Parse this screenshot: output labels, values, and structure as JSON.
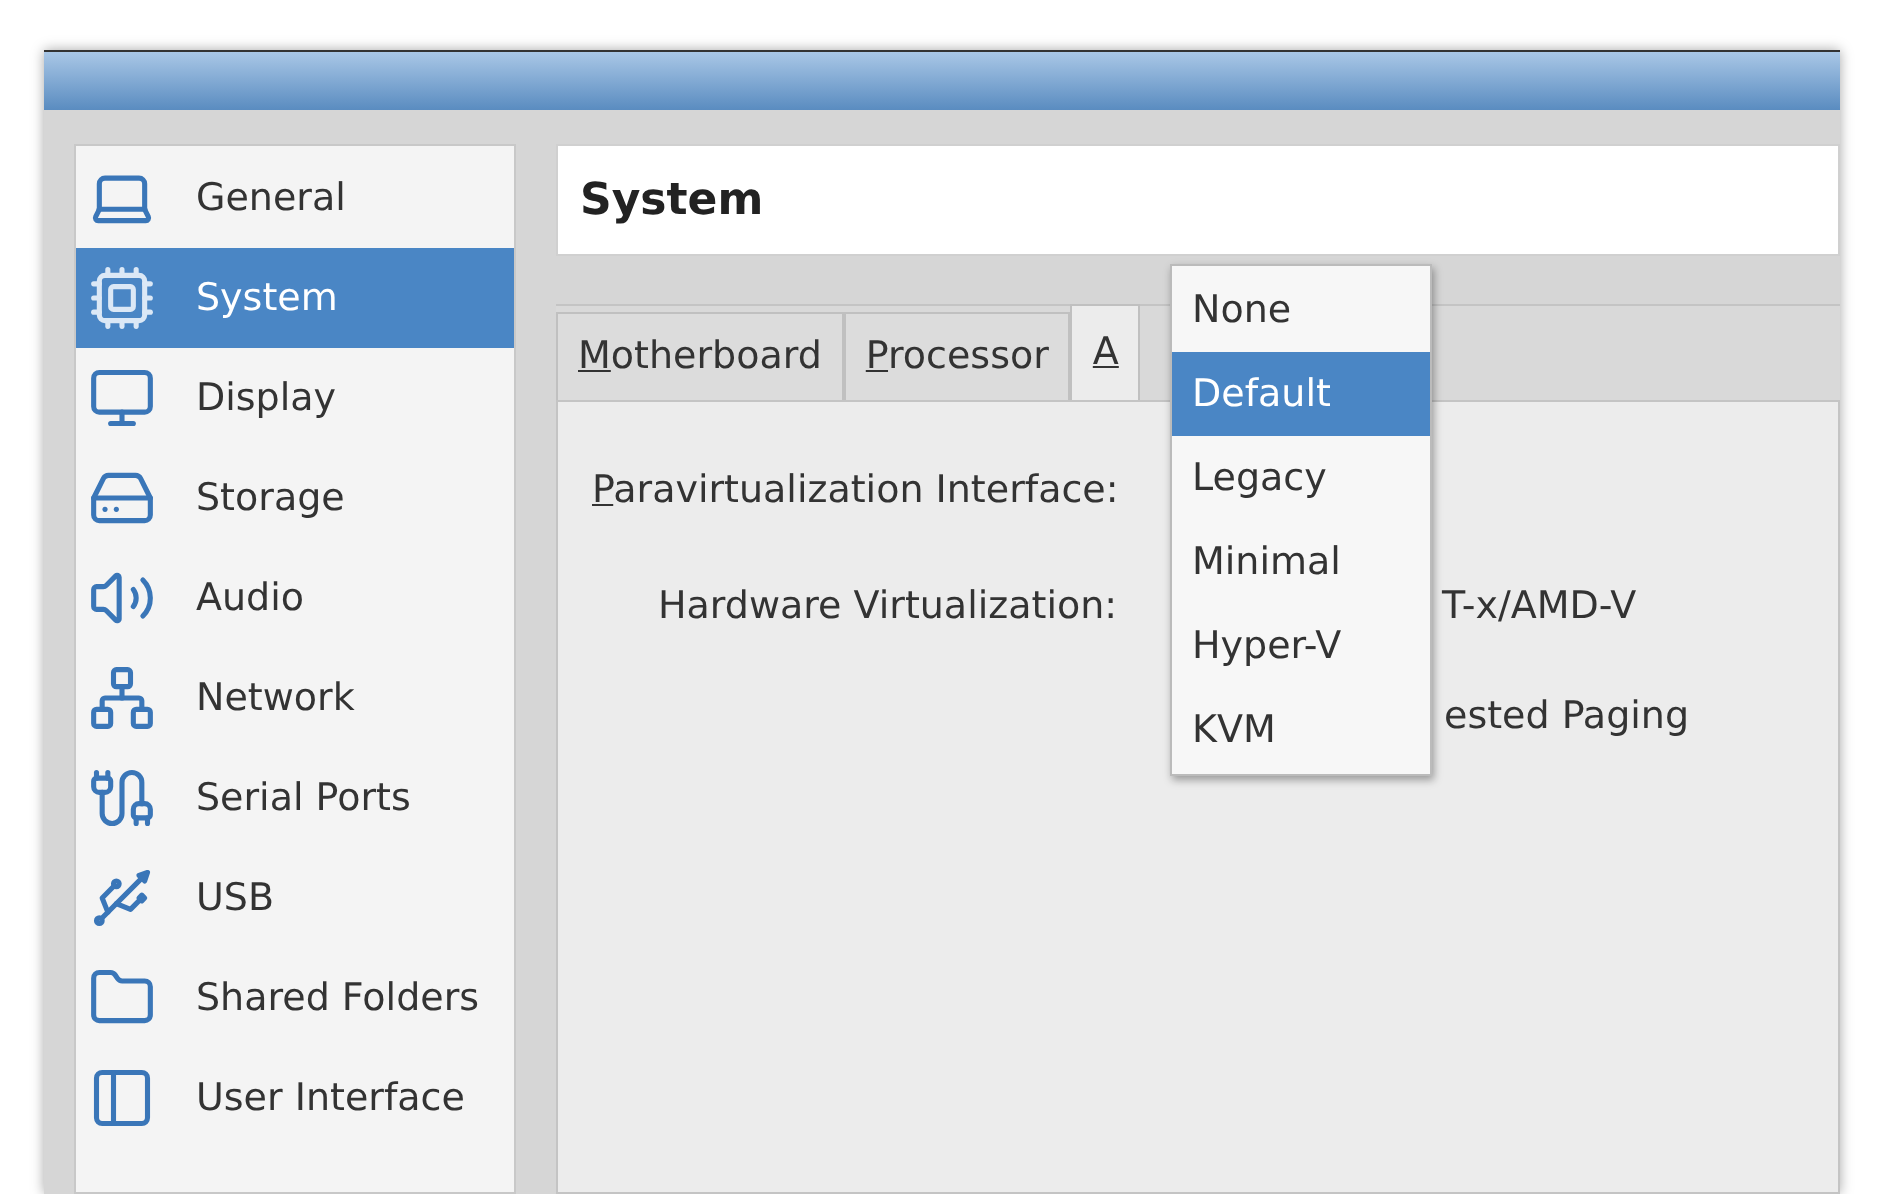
{
  "sidebar": {
    "items": [
      {
        "label": "General",
        "selected": false
      },
      {
        "label": "System",
        "selected": true
      },
      {
        "label": "Display",
        "selected": false
      },
      {
        "label": "Storage",
        "selected": false
      },
      {
        "label": "Audio",
        "selected": false
      },
      {
        "label": "Network",
        "selected": false
      },
      {
        "label": "Serial Ports",
        "selected": false
      },
      {
        "label": "USB",
        "selected": false
      },
      {
        "label": "Shared Folders",
        "selected": false
      },
      {
        "label": "User Interface",
        "selected": false
      }
    ]
  },
  "page_title": "System",
  "tabs": [
    {
      "label": "Motherboard",
      "selected": false
    },
    {
      "label": "Processor",
      "selected": false
    },
    {
      "label": "A",
      "selected": true
    }
  ],
  "fields": {
    "paravirtualization_label": "Paravirtualization Interface:",
    "hardware_label": "Hardware Virtualization:",
    "hardware_value": "T-x/AMD-V",
    "paging_value": "ested Paging"
  },
  "dropdown": {
    "options": [
      {
        "label": "None",
        "selected": false
      },
      {
        "label": "Default",
        "selected": true
      },
      {
        "label": "Legacy",
        "selected": false
      },
      {
        "label": "Minimal",
        "selected": false
      },
      {
        "label": "Hyper-V",
        "selected": false
      },
      {
        "label": "KVM",
        "selected": false
      }
    ]
  }
}
